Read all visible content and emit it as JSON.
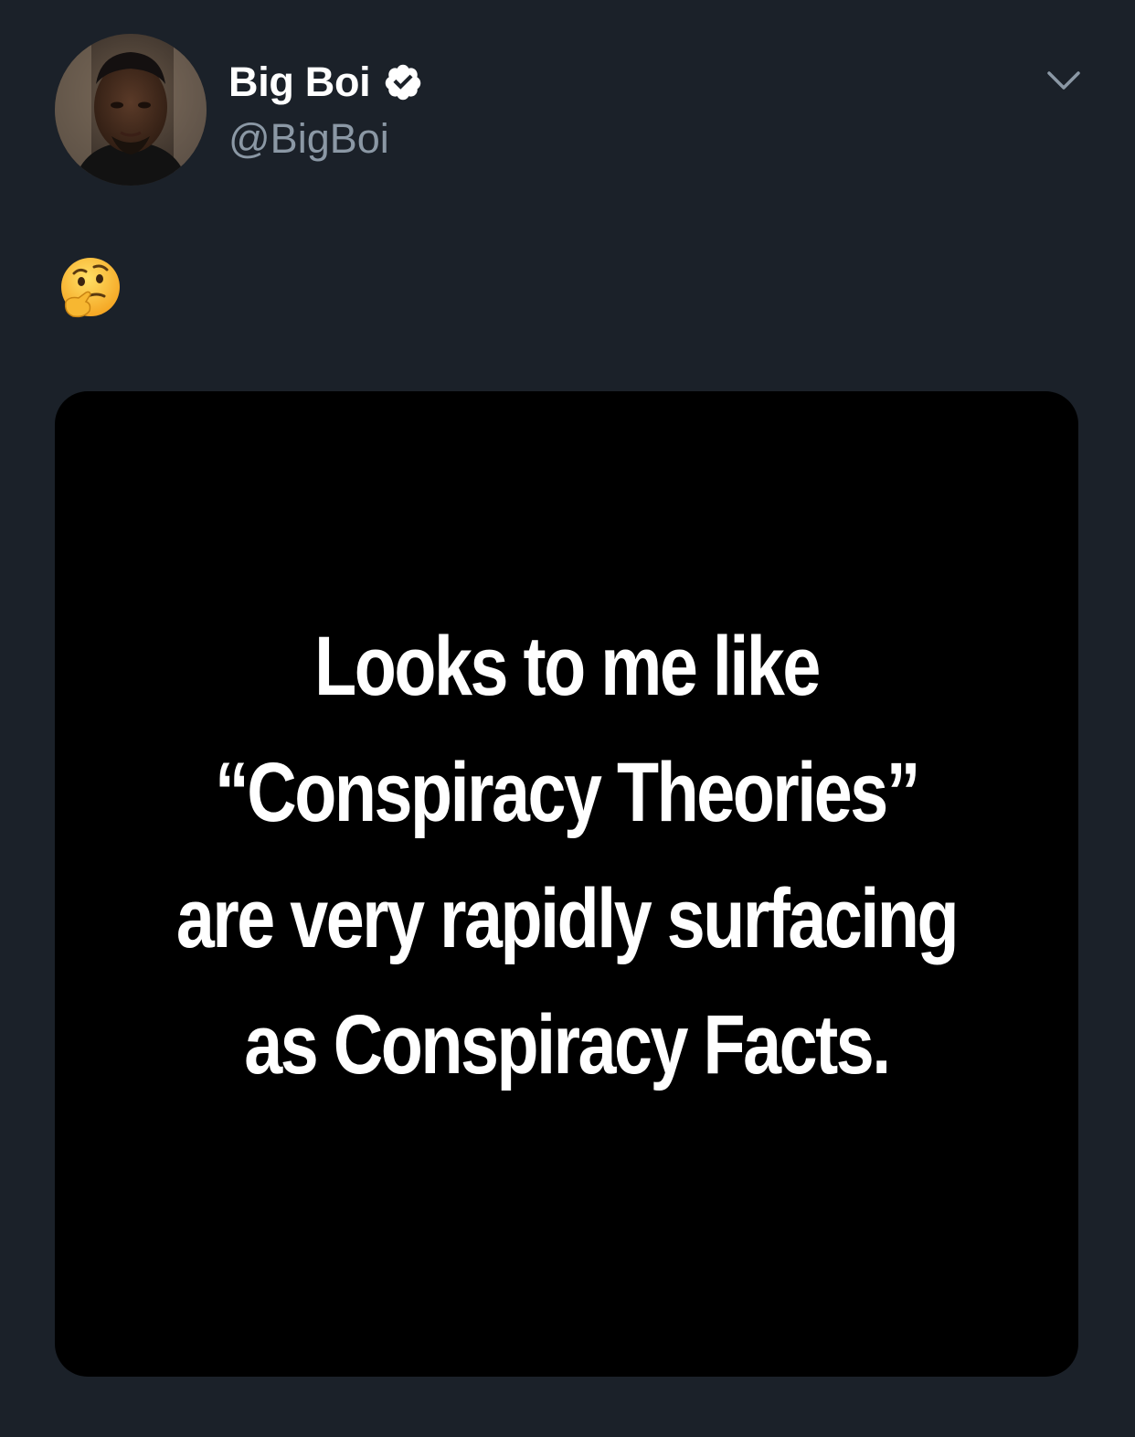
{
  "tweet": {
    "author": {
      "display_name": "Big Boi",
      "handle": "@BigBoi",
      "verified": true,
      "avatar": "profile-photo"
    },
    "text_emoji": "🤔",
    "menu_icon": "chevron-down-icon",
    "media": {
      "background": "#000000",
      "lines": [
        "Looks to me like",
        "“Conspiracy Theories”",
        "are very rapidly surfacing",
        "as Conspiracy Facts."
      ]
    }
  },
  "colors": {
    "background": "#1b2129",
    "name": "#ffffff",
    "handle": "#8b98a5",
    "verified_badge": "#ffffff"
  }
}
